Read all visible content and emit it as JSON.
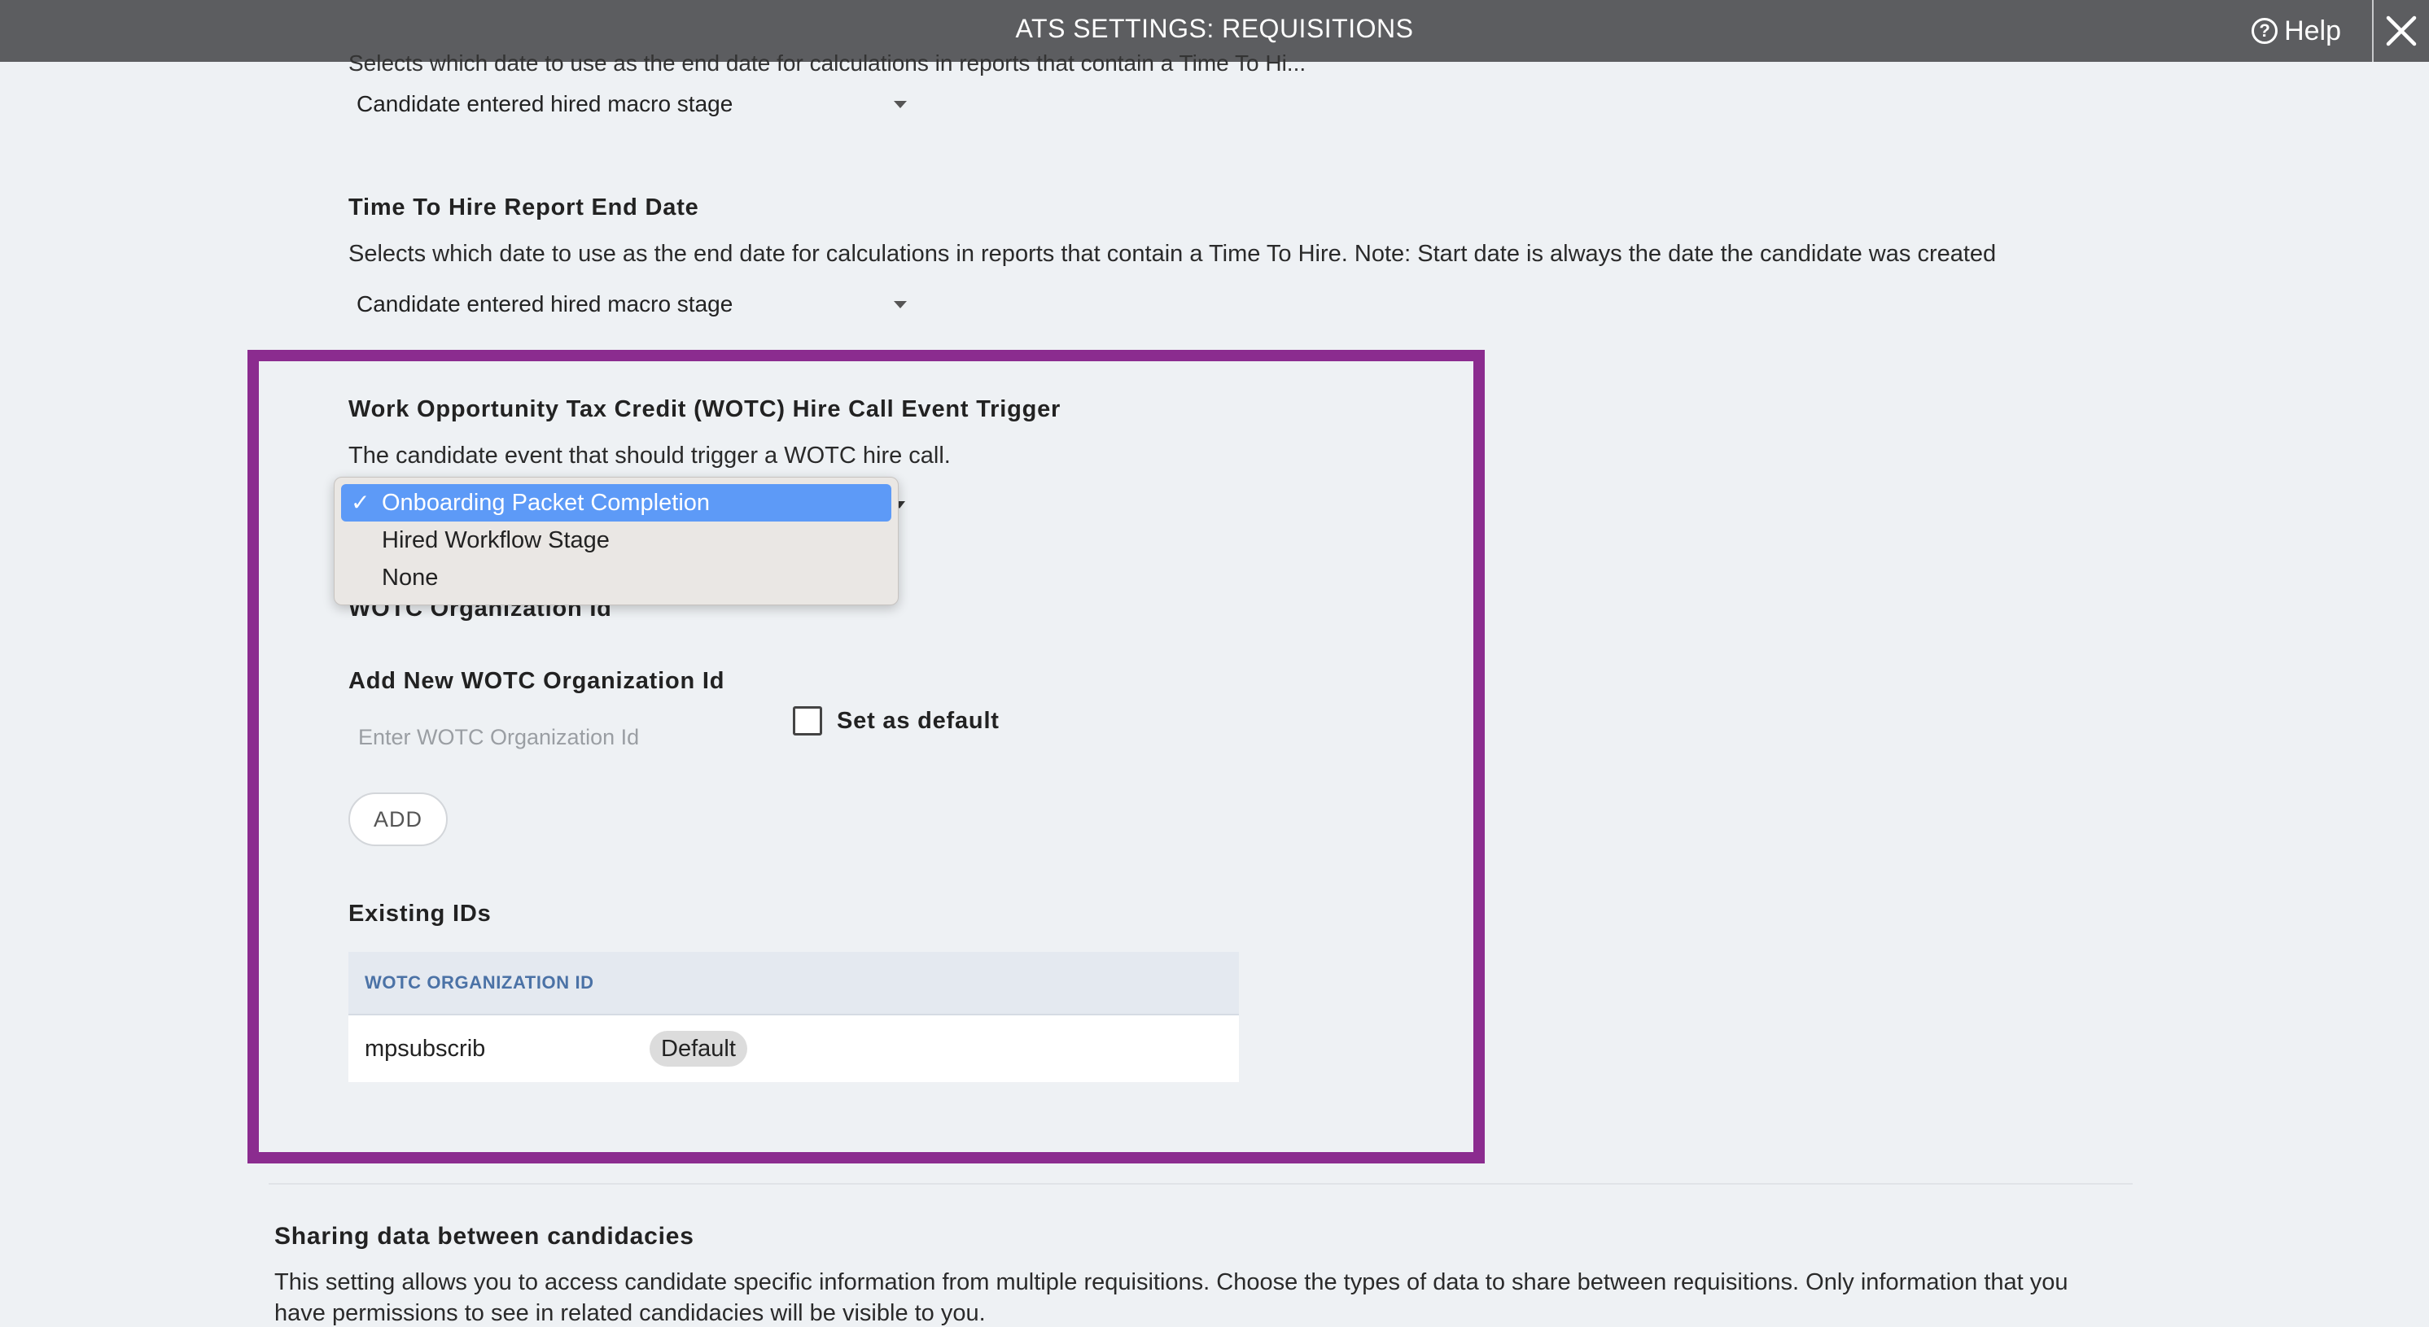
{
  "app": {
    "title": "ATS SETTINGS: REQUISITIONS",
    "help_label": "Help"
  },
  "top_section": {
    "cut_description": "Selects which date to use as the end date for calculations in reports that contain a Time To Hi...",
    "select_value": "Candidate entered hired macro stage"
  },
  "time_to_hire": {
    "heading": "Time To Hire Report End Date",
    "description": "Selects which date to use as the end date for calculations in reports that contain a Time To Hire. Note: Start date is always the date the candidate was created",
    "select_value": "Candidate entered hired macro stage"
  },
  "wotc": {
    "heading": "Work Opportunity Tax Credit (WOTC) Hire Call Event Trigger",
    "description": "The candidate event that should trigger a WOTC hire call.",
    "dropdown": {
      "options": [
        "Onboarding Packet Completion",
        "Hired Workflow Stage",
        "None"
      ],
      "selected_index": 0,
      "check_glyph": "✓"
    },
    "org_id_heading": "WOTC Organization Id",
    "add_heading": "Add New WOTC Organization Id",
    "input_placeholder": "Enter WOTC Organization Id",
    "input_value": "",
    "checkbox_label": "Set as default",
    "checkbox_checked": false,
    "add_button": "ADD",
    "existing_heading": "Existing IDs",
    "table": {
      "column_header": "WOTC ORGANIZATION ID",
      "rows": [
        {
          "id": "mpsubscrib",
          "badge": "Default"
        }
      ]
    }
  },
  "sharing": {
    "heading": "Sharing data between candidacies",
    "description_line1": "This setting allows you to access candidate specific information from multiple requisitions. Choose the types of data to share between requisitions. Only information that you",
    "description_line2": "have permissions to see in related candidacies will be visible to you."
  },
  "colors": {
    "topbar": "#5c5d60",
    "highlight": "#8b2c8f",
    "selected_option": "#5d9af7",
    "table_header_text": "#4b72a6"
  }
}
